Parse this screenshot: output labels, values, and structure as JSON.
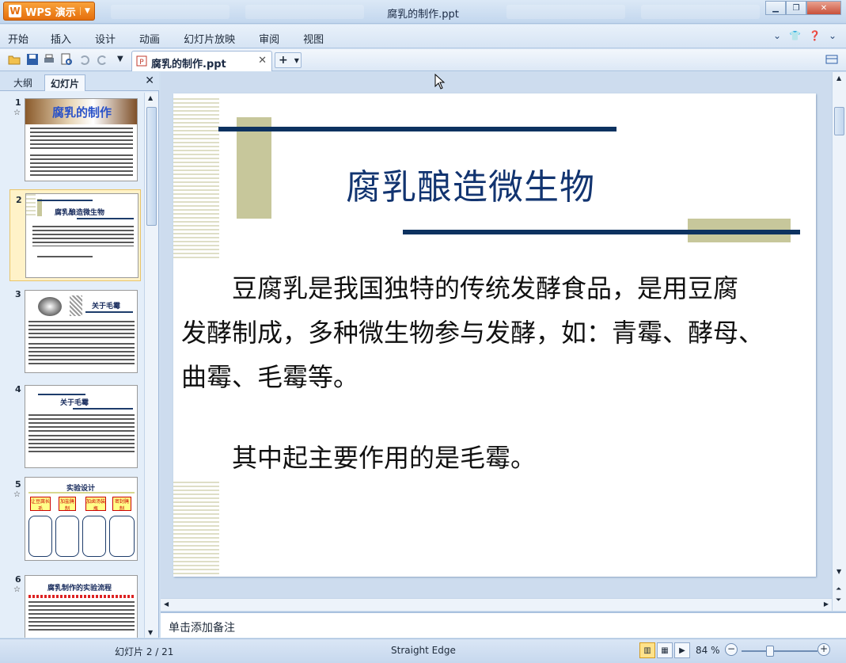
{
  "app": {
    "name": "WPS 演示",
    "window_title": "腐乳的制作.ppt"
  },
  "menu": [
    "开始",
    "插入",
    "设计",
    "动画",
    "幻灯片放映",
    "审阅",
    "视图"
  ],
  "toolbar": {
    "doc_tab": "腐乳的制作.ppt",
    "new_tab": "+"
  },
  "panel": {
    "tabs": [
      "大纲",
      "幻灯片"
    ],
    "active_tab": "幻灯片"
  },
  "thumbnails": [
    {
      "num": "1",
      "title": "腐乳的制作",
      "starred": true
    },
    {
      "num": "2",
      "title": "腐乳酿造微生物",
      "starred": false,
      "active": true
    },
    {
      "num": "3",
      "title": "关于毛霉",
      "starred": false
    },
    {
      "num": "4",
      "title": "关于毛霉",
      "starred": false
    },
    {
      "num": "5",
      "title": "实验设计",
      "starred": true,
      "steps": [
        "让豆腐长毛",
        "加盐腌制",
        "加卤汤装瓶",
        "密封腌制"
      ]
    },
    {
      "num": "6",
      "title": "腐乳制作的实验流程",
      "starred": true
    }
  ],
  "slide": {
    "title": "腐乳酿造微生物",
    "paragraph1": "　　豆腐乳是我国独特的传统发酵食品，是用豆腐\n发酵制成，多种微生物参与发酵，如：青霉、酵母、\n曲霉、毛霉等。",
    "paragraph2": "　　其中起主要作用的是毛霉。",
    "accent_colors": {
      "title": "#123470",
      "bar": "#0d3260",
      "block": "#c7c79b"
    }
  },
  "notes_placeholder": "单击添加备注",
  "status": {
    "slide_indicator": "幻灯片 2 / 21",
    "theme": "Straight Edge",
    "zoom": "84 %"
  }
}
